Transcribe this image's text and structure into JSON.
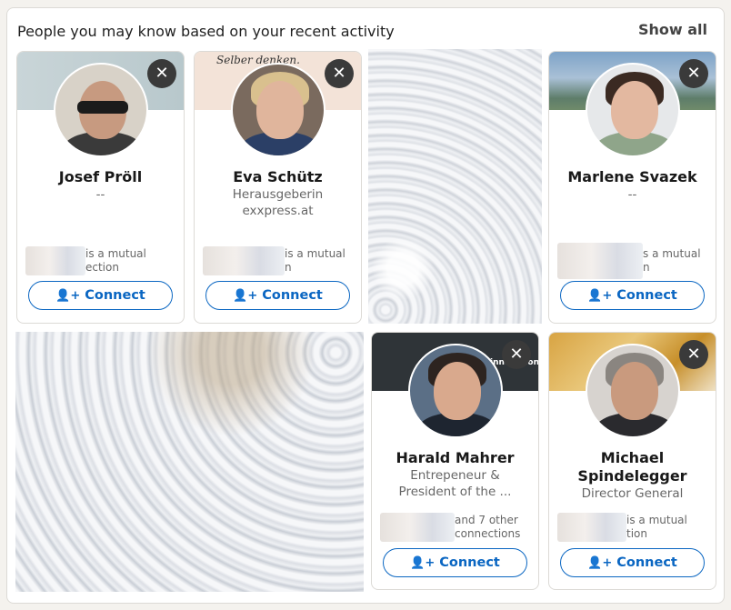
{
  "header": {
    "title": "People you may know based on your recent activity",
    "show_all": "Show all"
  },
  "icons": {
    "dismiss": "close-icon",
    "connect": "person-add-icon"
  },
  "colors": {
    "accent": "#0a66c2",
    "dismiss_bg": "#3a3a3a"
  },
  "cards": [
    {
      "name": "Josef Pröll",
      "subtitle1": "--",
      "subtitle2": "",
      "mutual": "is a mutual\nection",
      "connect": "Connect"
    },
    {
      "name": "Eva Schütz",
      "subtitle1": "Herausgeberin",
      "subtitle2": "exxpress.at",
      "mutual": "is a mutual\nn",
      "connect": "Connect",
      "banner_text": "Selber denken."
    },
    {
      "name": "Marlene Svazek",
      "subtitle1": "--",
      "subtitle2": "",
      "mutual": "s a mutual\nn",
      "connect": "Connect"
    },
    {
      "name": "Harald Mahrer",
      "subtitle1": "Entrepeneur &",
      "subtitle2": "President of the ...",
      "mutual": "and 7 other\nconnections",
      "connect": "Connect",
      "banner_text": "innovationm"
    },
    {
      "name": "Michael Spindelegger",
      "subtitle1": "Director General",
      "subtitle2": "",
      "mutual": "is a mutual\ntion",
      "connect": "Connect"
    }
  ],
  "buttons": {
    "dismiss_symbol": "✕",
    "connect_icon_symbol": "👤+"
  }
}
